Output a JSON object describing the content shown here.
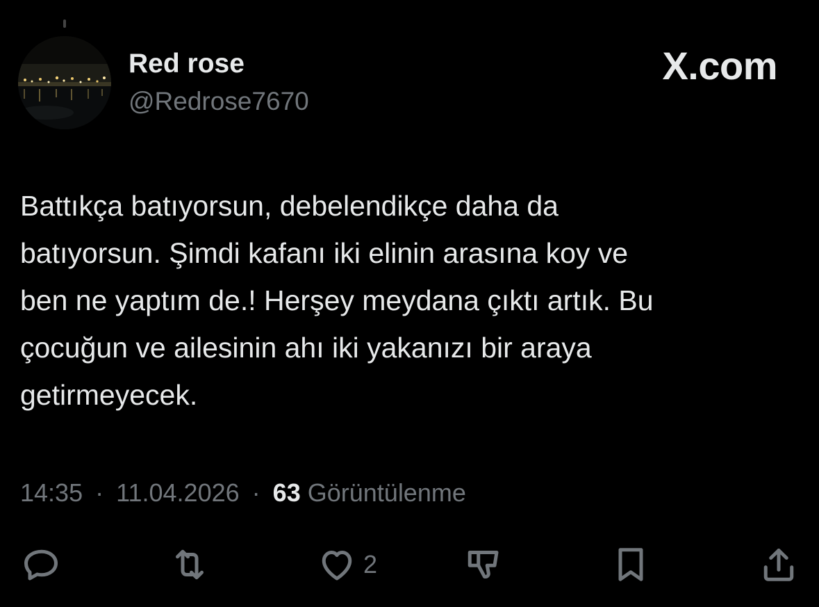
{
  "app": {
    "watermark": "X.com"
  },
  "author": {
    "display_name": "Red rose",
    "handle": "@Redrose7670",
    "avatar_icon": "night-harbor-avatar"
  },
  "tweet": {
    "text": "Battıkça batıyorsun, debelendikçe daha da\nbatıyorsun. Şimdi kafanı iki elinin arasına koy ve\nben ne yaptım de.! Herşey meydana çıktı artık. Bu\nçocuğun ve ailesinin ahı iki yakanızı bir araya\ngetirmeyecek.",
    "time": "14:35",
    "date": "11.04.2026",
    "separator": "·",
    "views_count": "63",
    "views_label": "Görüntülenme"
  },
  "actions": {
    "reply_icon": "reply-icon",
    "retweet_icon": "retweet-icon",
    "like_icon": "heart-icon",
    "like_count": "2",
    "dislike_icon": "dislike-icon",
    "bookmark_icon": "bookmark-icon",
    "share_icon": "share-icon"
  },
  "colors": {
    "background": "#000000",
    "text_primary": "#e7e9ea",
    "text_secondary": "#71767b"
  }
}
